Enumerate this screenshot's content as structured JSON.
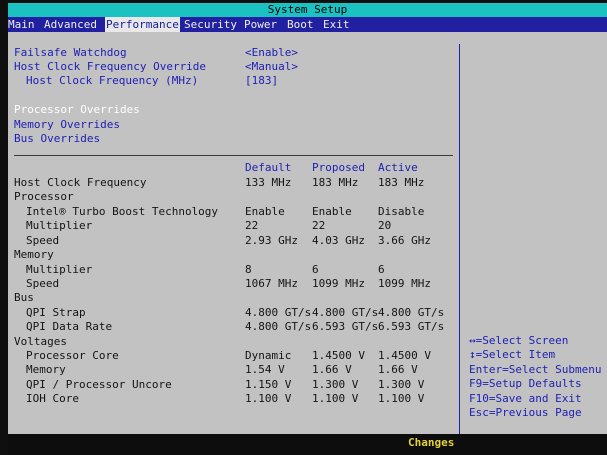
{
  "window": {
    "title": "System Setup"
  },
  "menu": {
    "items": [
      {
        "label": "Main"
      },
      {
        "label": "Advanced"
      },
      {
        "label": "Performance"
      },
      {
        "label": "Security"
      },
      {
        "label": "Power"
      },
      {
        "label": "Boot"
      },
      {
        "label": "Exit"
      }
    ],
    "active": "Performance"
  },
  "settings": [
    {
      "label": "Failsafe Watchdog",
      "value": "<Enable>"
    },
    {
      "label": "Host Clock Frequency Override",
      "value": "<Manual>"
    },
    {
      "label": "Host Clock Frequency (MHz)",
      "value": "[183]"
    }
  ],
  "submenus": [
    {
      "label": "Processor Overrides",
      "selected": true
    },
    {
      "label": "Memory Overrides",
      "selected": false
    },
    {
      "label": "Bus Overrides",
      "selected": false
    }
  ],
  "table": {
    "columns": [
      "Default",
      "Proposed",
      "Active"
    ],
    "rows": [
      {
        "label": "Host Clock Frequency",
        "values": [
          "133 MHz",
          "183 MHz",
          "183 MHz"
        ]
      },
      {
        "label": "Processor",
        "values": [
          "",
          "",
          ""
        ]
      },
      {
        "label": "Intel® Turbo Boost Technology",
        "values": [
          "Enable",
          "Enable",
          "Disable"
        ]
      },
      {
        "label": "Multiplier",
        "values": [
          "22",
          "22",
          "20"
        ]
      },
      {
        "label": "Speed",
        "values": [
          "2.93 GHz",
          "4.03 GHz",
          "3.66 GHz"
        ]
      },
      {
        "label": "Memory",
        "values": [
          "",
          "",
          ""
        ]
      },
      {
        "label": "Multiplier",
        "values": [
          "8",
          "6",
          "6"
        ]
      },
      {
        "label": "Speed",
        "values": [
          "1067 MHz",
          "1099 MHz",
          "1099 MHz"
        ]
      },
      {
        "label": "Bus",
        "values": [
          "",
          "",
          ""
        ]
      },
      {
        "label": "QPI Strap",
        "values": [
          "4.800 GT/s",
          "4.800 GT/s",
          "4.800 GT/s"
        ]
      },
      {
        "label": "QPI Data Rate",
        "values": [
          "4.800 GT/s",
          "6.593 GT/s",
          "6.593 GT/s"
        ]
      },
      {
        "label": "Voltages",
        "values": [
          "",
          "",
          ""
        ]
      },
      {
        "label": "Processor Core",
        "values": [
          "Dynamic",
          "1.4500 V",
          "1.4500 V"
        ]
      },
      {
        "label": "Memory",
        "values": [
          "1.54 V",
          "1.66 V",
          "1.66 V"
        ]
      },
      {
        "label": "QPI / Processor Uncore",
        "values": [
          "1.150 V",
          "1.300 V",
          "1.300 V"
        ]
      },
      {
        "label": "IOH Core",
        "values": [
          "1.100 V",
          "1.100 V",
          "1.100 V"
        ]
      }
    ]
  },
  "help": [
    {
      "key": "↔",
      "text": "=Select Screen"
    },
    {
      "key": "↕",
      "text": "=Select Item"
    },
    {
      "key": "Enter",
      "text": "=Select Submenu"
    },
    {
      "key": "F9",
      "text": "=Setup Defaults"
    },
    {
      "key": "F10",
      "text": "=Save and Exit"
    },
    {
      "key": "Esc",
      "text": "=Previous Page"
    }
  ],
  "status": {
    "label": "Changes"
  }
}
